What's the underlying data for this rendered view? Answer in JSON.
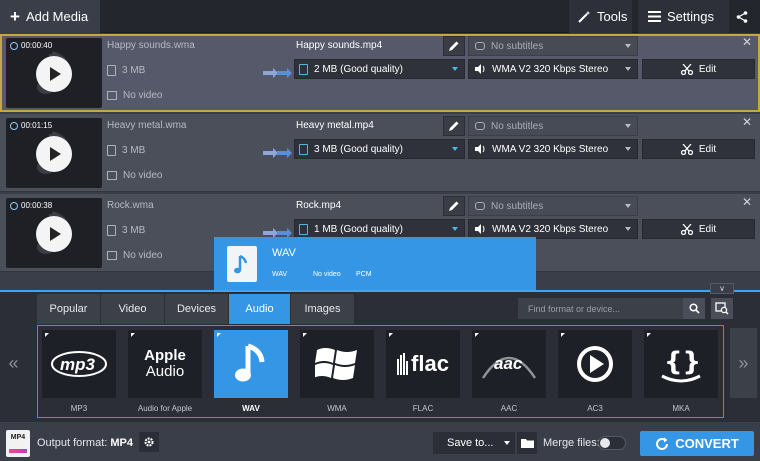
{
  "topbar": {
    "add_media": "Add Media",
    "tools": "Tools",
    "settings": "Settings"
  },
  "files": [
    {
      "duration": "00:00:40",
      "source_name": "Happy sounds.wma",
      "source_size": "3 MB",
      "source_video": "No video",
      "output_name": "Happy sounds.mp4",
      "quality": "2 MB (Good quality)",
      "subtitles": "No subtitles",
      "audio": "WMA V2 320 Kbps Stereo",
      "edit": "Edit",
      "selected": true
    },
    {
      "duration": "00:01:15",
      "source_name": "Heavy metal.wma",
      "source_size": "3 MB",
      "source_video": "No video",
      "output_name": "Heavy metal.mp4",
      "quality": "3 MB (Good quality)",
      "subtitles": "No subtitles",
      "audio": "WMA V2 320 Kbps Stereo",
      "edit": "Edit",
      "selected": false
    },
    {
      "duration": "00:00:38",
      "source_name": "Rock.wma",
      "source_size": "3 MB",
      "source_video": "No video",
      "output_name": "Rock.mp4",
      "quality": "1 MB (Good quality)",
      "subtitles": "No subtitles",
      "audio": "WMA V2 320 Kbps Stereo",
      "edit": "Edit",
      "selected": false
    }
  ],
  "tooltip": {
    "name": "WAV",
    "format": "WAV",
    "video": "No video",
    "codec": "PCM"
  },
  "tabs": [
    "Popular",
    "Video",
    "Devices",
    "Audio",
    "Images"
  ],
  "active_tab": "Audio",
  "search": {
    "placeholder": "Find format or device..."
  },
  "formats": [
    {
      "label": "MP3",
      "icon": "mp3-logo"
    },
    {
      "label": "Audio for Apple",
      "icon": "apple-audio-logo",
      "tile_line1": "Apple",
      "tile_line2": "Audio"
    },
    {
      "label": "WAV",
      "icon": "music-note",
      "active": true
    },
    {
      "label": "WMA",
      "icon": "windows-logo"
    },
    {
      "label": "FLAC",
      "icon": "flac-logo",
      "tile_text": "flac"
    },
    {
      "label": "AAC",
      "icon": "aac-logo",
      "tile_text": "aac"
    },
    {
      "label": "AC3",
      "icon": "ac3-logo"
    },
    {
      "label": "MKA",
      "icon": "mka-logo"
    }
  ],
  "footer": {
    "output_format_label": "Output format:",
    "output_format_value": "MP4",
    "icon_text": "MP4",
    "save_to": "Save to...",
    "merge_files": "Merge files:",
    "convert": "CONVERT"
  },
  "colors": {
    "accent": "#3596e6",
    "selected_outline": "#c9a54a"
  }
}
